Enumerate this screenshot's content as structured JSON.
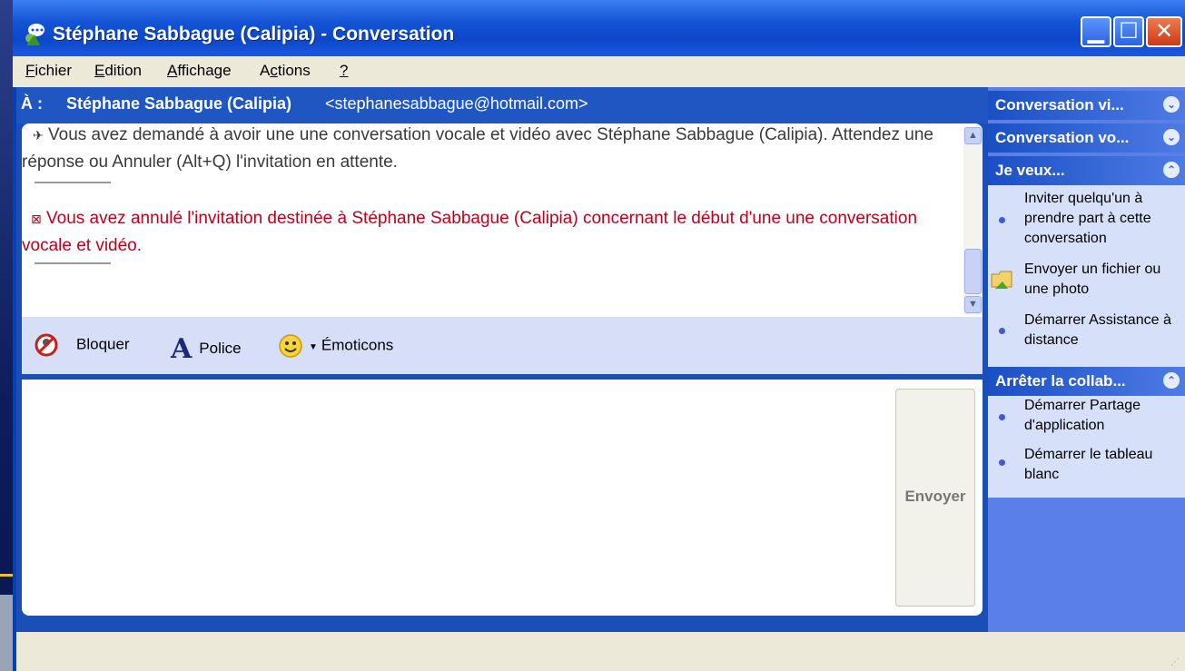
{
  "window": {
    "title": "Stéphane Sabbague (Calipia) - Conversation"
  },
  "menu": [
    {
      "label": "Fichier",
      "u": "F",
      "rest": "ichier"
    },
    {
      "label": "Edition",
      "u": "E",
      "rest": "dition"
    },
    {
      "label": "Affichage",
      "u": "A",
      "rest": "ffichage"
    },
    {
      "label": "Actions",
      "pre": "A",
      "u": "c",
      "rest": "tions"
    },
    {
      "label": "?",
      "u": "?",
      "rest": ""
    }
  ],
  "to": {
    "label": "À :",
    "name": "Stéphane Sabbague (Calipia)",
    "email": "<stephanesabbague@hotmail.com>"
  },
  "history": {
    "message1": "Vous avez demandé à avoir une une conversation vocale et vidéo avec Stéphane Sabbague (Calipia). Attendez une réponse ou Annuler (Alt+Q) l'invitation en attente.",
    "message2": "Vous avez annulé l'invitation destinée à Stéphane Sabbague (Calipia) concernant le début d'une une conversation vocale et vidéo."
  },
  "toolbar": {
    "block": "Bloquer",
    "font": "Police",
    "emoticons": "Émoticons"
  },
  "compose": {
    "send_label": "Envoyer"
  },
  "side": {
    "panel1": "Conversation vi...",
    "panel2": "Conversation vo...",
    "panel3": "Je veux...",
    "tasks1": [
      "Inviter quelqu'un à prendre part à cette conversation",
      "Envoyer un fichier ou une photo",
      "Démarrer Assistance à distance"
    ],
    "panel4": "Arrêter la collab...",
    "tasks2": [
      "Démarrer Partage d'application",
      "Démarrer le tableau blanc"
    ]
  },
  "colors": {
    "accent": "#1452d6",
    "error_text": "#c0001a",
    "sidebar_bg": "#5a7fe6"
  }
}
